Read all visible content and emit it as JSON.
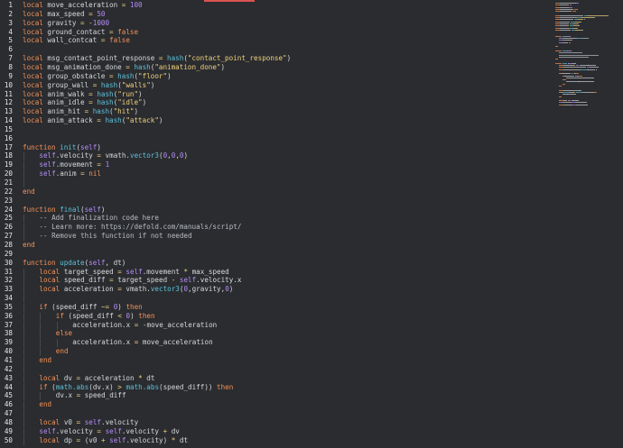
{
  "editor": {
    "lines": [
      {
        "n": "1",
        "segs": [
          [
            "kw",
            "local"
          ],
          [
            "t",
            " move_acceleration "
          ],
          [
            "op",
            "="
          ],
          [
            "t",
            " "
          ],
          [
            "num",
            "100"
          ]
        ]
      },
      {
        "n": "2",
        "segs": [
          [
            "kw",
            "local"
          ],
          [
            "t",
            " max_speed "
          ],
          [
            "op",
            "="
          ],
          [
            "t",
            " "
          ],
          [
            "num",
            "50"
          ]
        ]
      },
      {
        "n": "3",
        "segs": [
          [
            "kw",
            "local"
          ],
          [
            "t",
            " gravity "
          ],
          [
            "op",
            "="
          ],
          [
            "t",
            " "
          ],
          [
            "op",
            "-"
          ],
          [
            "num",
            "1000"
          ]
        ]
      },
      {
        "n": "4",
        "segs": [
          [
            "kw",
            "local"
          ],
          [
            "t",
            " ground_contact "
          ],
          [
            "op",
            "="
          ],
          [
            "t",
            " "
          ],
          [
            "kw",
            "false"
          ]
        ]
      },
      {
        "n": "5",
        "segs": [
          [
            "kw",
            "local"
          ],
          [
            "t",
            " wall_contcat "
          ],
          [
            "op",
            "="
          ],
          [
            "t",
            " "
          ],
          [
            "kw",
            "false"
          ]
        ]
      },
      {
        "n": "6",
        "segs": []
      },
      {
        "n": "7",
        "segs": [
          [
            "kw",
            "local"
          ],
          [
            "t",
            " msg_contact_point_response "
          ],
          [
            "op",
            "="
          ],
          [
            "t",
            " "
          ],
          [
            "fn",
            "hash"
          ],
          [
            "t",
            "("
          ],
          [
            "str",
            "\"contact_point_response\""
          ],
          [
            "t",
            ")"
          ]
        ]
      },
      {
        "n": "8",
        "segs": [
          [
            "kw",
            "local"
          ],
          [
            "t",
            " msg_animation_done "
          ],
          [
            "op",
            "="
          ],
          [
            "t",
            " "
          ],
          [
            "fn",
            "hash"
          ],
          [
            "t",
            "("
          ],
          [
            "str",
            "\"animation_done\""
          ],
          [
            "t",
            ")"
          ]
        ]
      },
      {
        "n": "9",
        "segs": [
          [
            "kw",
            "local"
          ],
          [
            "t",
            " group_obstacle "
          ],
          [
            "op",
            "="
          ],
          [
            "t",
            " "
          ],
          [
            "fn",
            "hash"
          ],
          [
            "t",
            "("
          ],
          [
            "str",
            "\"floor\""
          ],
          [
            "t",
            ")"
          ]
        ]
      },
      {
        "n": "10",
        "segs": [
          [
            "kw",
            "local"
          ],
          [
            "t",
            " group_wall "
          ],
          [
            "op",
            "="
          ],
          [
            "t",
            " "
          ],
          [
            "fn",
            "hash"
          ],
          [
            "t",
            "("
          ],
          [
            "str",
            "\"walls\""
          ],
          [
            "t",
            ")"
          ]
        ]
      },
      {
        "n": "11",
        "segs": [
          [
            "kw",
            "local"
          ],
          [
            "t",
            " anim_walk "
          ],
          [
            "op",
            "="
          ],
          [
            "t",
            " "
          ],
          [
            "fn",
            "hash"
          ],
          [
            "t",
            "("
          ],
          [
            "str",
            "\"run\""
          ],
          [
            "t",
            ")"
          ]
        ]
      },
      {
        "n": "12",
        "segs": [
          [
            "kw",
            "local"
          ],
          [
            "t",
            " anim_idle "
          ],
          [
            "op",
            "="
          ],
          [
            "t",
            " "
          ],
          [
            "fn",
            "hash"
          ],
          [
            "t",
            "("
          ],
          [
            "str",
            "\"idle\""
          ],
          [
            "t",
            ")"
          ]
        ]
      },
      {
        "n": "13",
        "segs": [
          [
            "kw",
            "local"
          ],
          [
            "t",
            " anim_hit "
          ],
          [
            "op",
            "="
          ],
          [
            "t",
            " "
          ],
          [
            "fn",
            "hash"
          ],
          [
            "t",
            "("
          ],
          [
            "str",
            "\"hit\""
          ],
          [
            "t",
            ")"
          ]
        ]
      },
      {
        "n": "14",
        "segs": [
          [
            "kw",
            "local"
          ],
          [
            "t",
            " anim_attack "
          ],
          [
            "op",
            "="
          ],
          [
            "t",
            " "
          ],
          [
            "fn",
            "hash"
          ],
          [
            "t",
            "("
          ],
          [
            "str",
            "\"attack\""
          ],
          [
            "t",
            ")"
          ]
        ]
      },
      {
        "n": "15",
        "segs": []
      },
      {
        "n": "16",
        "segs": []
      },
      {
        "n": "17",
        "segs": [
          [
            "kw",
            "function"
          ],
          [
            "t",
            " "
          ],
          [
            "fn",
            "init"
          ],
          [
            "t",
            "("
          ],
          [
            "self",
            "self"
          ],
          [
            "t",
            ")"
          ]
        ]
      },
      {
        "n": "18",
        "indent": 1,
        "segs": [
          [
            "self",
            "self"
          ],
          [
            "t",
            ".velocity "
          ],
          [
            "op",
            "="
          ],
          [
            "t",
            " vmath."
          ],
          [
            "fn",
            "vector3"
          ],
          [
            "t",
            "("
          ],
          [
            "num",
            "0"
          ],
          [
            "t",
            ","
          ],
          [
            "num",
            "0"
          ],
          [
            "t",
            ","
          ],
          [
            "num",
            "0"
          ],
          [
            "t",
            ")"
          ]
        ]
      },
      {
        "n": "19",
        "indent": 1,
        "segs": [
          [
            "self",
            "self"
          ],
          [
            "t",
            ".movement "
          ],
          [
            "op",
            "="
          ],
          [
            "t",
            " "
          ],
          [
            "num",
            "1"
          ]
        ]
      },
      {
        "n": "20",
        "indent": 1,
        "segs": [
          [
            "self",
            "self"
          ],
          [
            "t",
            ".anim "
          ],
          [
            "op",
            "="
          ],
          [
            "t",
            " "
          ],
          [
            "kw",
            "nil"
          ]
        ]
      },
      {
        "n": "21",
        "indent": 1,
        "segs": []
      },
      {
        "n": "22",
        "segs": [
          [
            "kw",
            "end"
          ]
        ]
      },
      {
        "n": "23",
        "segs": []
      },
      {
        "n": "24",
        "segs": [
          [
            "kw",
            "function"
          ],
          [
            "t",
            " "
          ],
          [
            "fn",
            "final"
          ],
          [
            "t",
            "("
          ],
          [
            "self",
            "self"
          ],
          [
            "t",
            ")"
          ]
        ]
      },
      {
        "n": "25",
        "indent": 1,
        "segs": [
          [
            "cm",
            "-- Add finalization code here"
          ]
        ]
      },
      {
        "n": "26",
        "indent": 1,
        "segs": [
          [
            "cm",
            "-- Learn more: https://defold.com/manuals/script/"
          ]
        ]
      },
      {
        "n": "27",
        "indent": 1,
        "segs": [
          [
            "cm",
            "-- Remove this function if not needed"
          ]
        ]
      },
      {
        "n": "28",
        "segs": [
          [
            "kw",
            "end"
          ]
        ]
      },
      {
        "n": "29",
        "segs": []
      },
      {
        "n": "30",
        "segs": [
          [
            "kw",
            "function"
          ],
          [
            "t",
            " "
          ],
          [
            "fn",
            "update"
          ],
          [
            "t",
            "("
          ],
          [
            "self",
            "self"
          ],
          [
            "t",
            ", dt)"
          ]
        ]
      },
      {
        "n": "31",
        "indent": 1,
        "segs": [
          [
            "kw",
            "local"
          ],
          [
            "t",
            " target_speed "
          ],
          [
            "op",
            "="
          ],
          [
            "t",
            " "
          ],
          [
            "self",
            "self"
          ],
          [
            "t",
            ".movement "
          ],
          [
            "op",
            "*"
          ],
          [
            "t",
            " max_speed"
          ]
        ]
      },
      {
        "n": "32",
        "indent": 1,
        "segs": [
          [
            "kw",
            "local"
          ],
          [
            "t",
            " speed_diff "
          ],
          [
            "op",
            "="
          ],
          [
            "t",
            " target_speed "
          ],
          [
            "op",
            "-"
          ],
          [
            "t",
            " "
          ],
          [
            "self",
            "self"
          ],
          [
            "t",
            ".velocity.x"
          ]
        ]
      },
      {
        "n": "33",
        "indent": 1,
        "segs": [
          [
            "kw",
            "local"
          ],
          [
            "t",
            " acceleration "
          ],
          [
            "op",
            "="
          ],
          [
            "t",
            " vmath."
          ],
          [
            "fn",
            "vector3"
          ],
          [
            "t",
            "("
          ],
          [
            "num",
            "0"
          ],
          [
            "t",
            ",gravity,"
          ],
          [
            "num",
            "0"
          ],
          [
            "t",
            ")"
          ]
        ]
      },
      {
        "n": "34",
        "indent": 1,
        "segs": []
      },
      {
        "n": "35",
        "indent": 1,
        "segs": [
          [
            "kw",
            "if"
          ],
          [
            "t",
            " (speed_diff "
          ],
          [
            "op",
            "~="
          ],
          [
            "t",
            " "
          ],
          [
            "num",
            "0"
          ],
          [
            "t",
            ") "
          ],
          [
            "kw",
            "then"
          ]
        ]
      },
      {
        "n": "36",
        "indent": 2,
        "segs": [
          [
            "kw",
            "if"
          ],
          [
            "t",
            " (speed_diff "
          ],
          [
            "op",
            "<"
          ],
          [
            "t",
            " "
          ],
          [
            "num",
            "0"
          ],
          [
            "t",
            ") "
          ],
          [
            "kw",
            "then"
          ]
        ]
      },
      {
        "n": "37",
        "indent": 3,
        "segs": [
          [
            "t",
            "acceleration.x "
          ],
          [
            "op",
            "="
          ],
          [
            "t",
            " "
          ],
          [
            "op",
            "-"
          ],
          [
            "t",
            "move_acceleration"
          ]
        ]
      },
      {
        "n": "38",
        "indent": 2,
        "segs": [
          [
            "kw",
            "else"
          ]
        ]
      },
      {
        "n": "39",
        "indent": 3,
        "segs": [
          [
            "t",
            "acceleration.x "
          ],
          [
            "op",
            "="
          ],
          [
            "t",
            " move_acceleration"
          ]
        ]
      },
      {
        "n": "40",
        "indent": 2,
        "segs": [
          [
            "kw",
            "end"
          ]
        ]
      },
      {
        "n": "41",
        "indent": 1,
        "segs": [
          [
            "kw",
            "end"
          ]
        ]
      },
      {
        "n": "42",
        "indent": 1,
        "segs": []
      },
      {
        "n": "43",
        "indent": 1,
        "segs": [
          [
            "kw",
            "local"
          ],
          [
            "t",
            " dv "
          ],
          [
            "op",
            "="
          ],
          [
            "t",
            " acceleration "
          ],
          [
            "op",
            "*"
          ],
          [
            "t",
            " dt"
          ]
        ]
      },
      {
        "n": "44",
        "indent": 1,
        "segs": [
          [
            "kw",
            "if"
          ],
          [
            "t",
            " ("
          ],
          [
            "fn",
            "math.abs"
          ],
          [
            "t",
            "(dv.x) "
          ],
          [
            "op",
            ">"
          ],
          [
            "t",
            " "
          ],
          [
            "fn",
            "math.abs"
          ],
          [
            "t",
            "(speed_diff)) "
          ],
          [
            "kw",
            "then"
          ]
        ]
      },
      {
        "n": "45",
        "indent": 2,
        "segs": [
          [
            "t",
            "dv.x "
          ],
          [
            "op",
            "="
          ],
          [
            "t",
            " speed_diff"
          ]
        ]
      },
      {
        "n": "46",
        "indent": 1,
        "segs": [
          [
            "kw",
            "end"
          ]
        ]
      },
      {
        "n": "47",
        "indent": 1,
        "segs": []
      },
      {
        "n": "48",
        "indent": 1,
        "segs": [
          [
            "kw",
            "local"
          ],
          [
            "t",
            " v0 "
          ],
          [
            "op",
            "="
          ],
          [
            "t",
            " "
          ],
          [
            "self",
            "self"
          ],
          [
            "t",
            ".velocity"
          ]
        ]
      },
      {
        "n": "49",
        "indent": 1,
        "segs": [
          [
            "self",
            "self"
          ],
          [
            "t",
            ".velocity "
          ],
          [
            "op",
            "="
          ],
          [
            "t",
            " "
          ],
          [
            "self",
            "self"
          ],
          [
            "t",
            ".velocity "
          ],
          [
            "op",
            "+"
          ],
          [
            "t",
            " dv"
          ]
        ]
      },
      {
        "n": "50",
        "indent": 1,
        "segs": [
          [
            "kw",
            "local"
          ],
          [
            "t",
            " dp "
          ],
          [
            "op",
            "="
          ],
          [
            "t",
            " (v0 "
          ],
          [
            "op",
            "+"
          ],
          [
            "t",
            " "
          ],
          [
            "self",
            "self"
          ],
          [
            "t",
            ".velocity) "
          ],
          [
            "op",
            "*"
          ],
          [
            "t",
            " dt"
          ]
        ]
      }
    ]
  },
  "colors": {
    "background": "#2a2c30",
    "keyword": "#f49156",
    "function": "#5ec1d8",
    "string": "#f2d17b",
    "number": "#b58cf5",
    "comment": "#b9bcc1",
    "text": "#d7d9dc"
  }
}
